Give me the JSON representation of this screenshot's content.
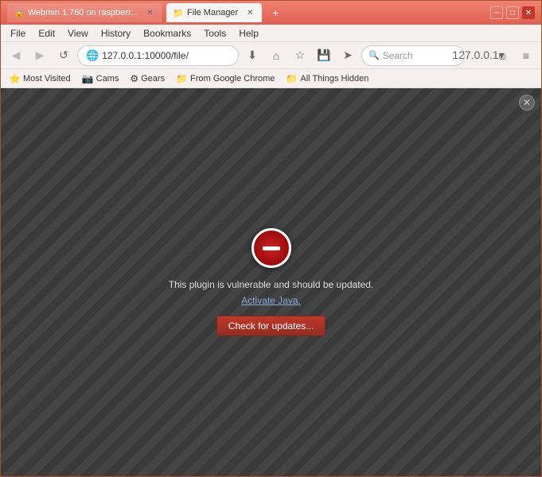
{
  "window": {
    "title": "File Manager",
    "controls": {
      "minimize": "─",
      "maximize": "□",
      "close": "✕"
    }
  },
  "tabs": [
    {
      "label": "Webmin 1.760 on raspberr...",
      "active": false,
      "favicon": "🔒"
    },
    {
      "label": "File Manager",
      "active": true,
      "favicon": "📁"
    }
  ],
  "new_tab_label": "+",
  "menubar": {
    "items": [
      "File",
      "Edit",
      "View",
      "History",
      "Bookmarks",
      "Tools",
      "Help"
    ]
  },
  "toolbar": {
    "back": "◀",
    "forward": "▶",
    "refresh": "↺",
    "home": "⌂",
    "address": "127.0.0.1:10000/file/",
    "search_placeholder": "Search",
    "download": "⬇",
    "bookmark_star": "☆",
    "bookmark_filled": "★",
    "save": "💾",
    "send": "➤",
    "user": "127.0.0.1▾",
    "smiley": "☺",
    "menu": "≡"
  },
  "bookmarks": [
    {
      "label": "Most Visited",
      "icon": "⭐"
    },
    {
      "label": "Cams",
      "icon": "📷"
    },
    {
      "label": "Gears",
      "icon": "⚙"
    },
    {
      "label": "From Google Chrome",
      "icon": "📁"
    },
    {
      "label": "All Things Hidden",
      "icon": "📁"
    }
  ],
  "plugin": {
    "message": "This plugin is vulnerable and should be updated.",
    "link": "Activate Java.",
    "button": "Check for updates...",
    "close": "✕"
  }
}
